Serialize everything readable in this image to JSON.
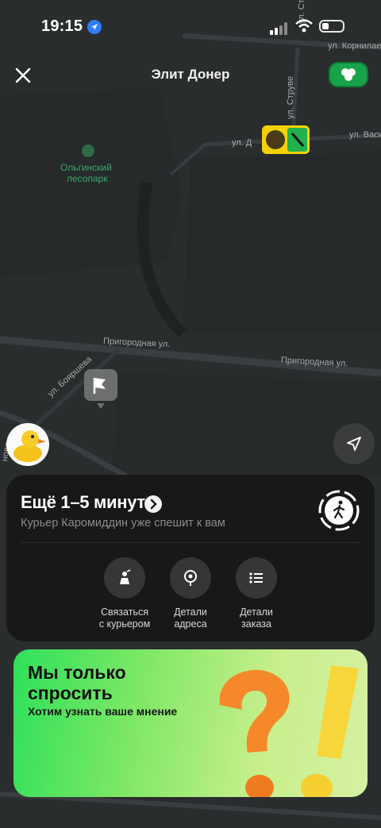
{
  "status_bar": {
    "time": "19:15"
  },
  "header": {
    "title": "Элит Донер"
  },
  "map": {
    "labels": {
      "park_line1": "Ольгинский",
      "park_line2": "лесопарк",
      "street_prigorodnaya_1": "Пригородная ул.",
      "street_prigorodnaya_2": "Пригородная ул.",
      "street_boyarsheva": "ул. Бояршева",
      "street_struve": "ул. Струве",
      "street_kornilaev": "ул. Корнилаев",
      "street_vasi": "ул. Васи",
      "street_d": "ул. Д",
      "street_top": "ул. Ст",
      "street_left": "нова"
    }
  },
  "order": {
    "eta": "Ещё 1–5 минут",
    "courier_status": "Курьер Каромиддин уже спешит к вам",
    "actions": [
      {
        "line1": "Связаться",
        "line2": "с курьером"
      },
      {
        "line1": "Детали",
        "line2": "адреса"
      },
      {
        "line1": "Детали",
        "line2": "заказа"
      }
    ]
  },
  "promo": {
    "title_line1": "Мы только",
    "title_line2": "спросить",
    "subtitle": "Хотим узнать ваше мнение"
  },
  "colors": {
    "accent_green": "#17a34a",
    "courier_yellow": "#f2d200",
    "sheet_bg": "#181818"
  }
}
